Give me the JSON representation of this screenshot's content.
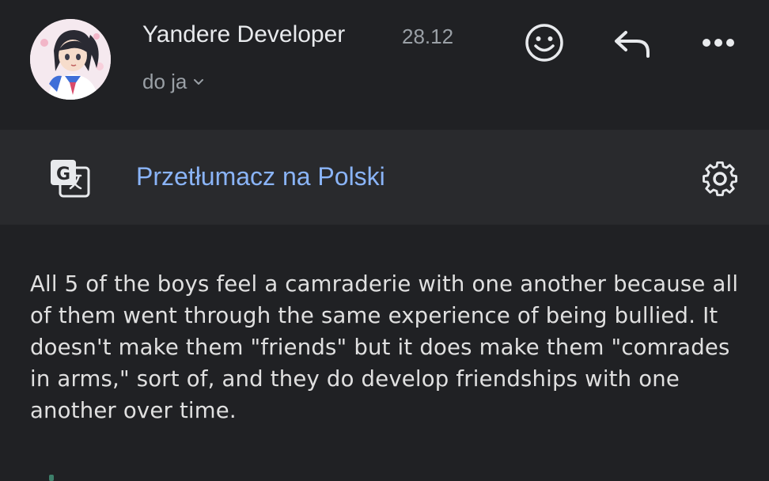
{
  "email": {
    "sender_name": "Yandere Developer",
    "date": "28.12",
    "recipient_label": "do ja",
    "body": "All 5 of the boys feel a camraderie with one another because all of them went through the same experience of being bullied. It doesn't make them \"friends\" but it does make them \"comrades in arms,\" sort of, and they do develop friendships with one another over time."
  },
  "toolbar": {
    "icons": [
      "emoji-icon",
      "reply-icon",
      "more-icon"
    ]
  },
  "translate": {
    "link_label": "Przetłumacz na Polski",
    "icons": [
      "google-translate-icon",
      "gear-icon"
    ]
  },
  "colors": {
    "background": "#202124",
    "translate_bar": "#292a2d",
    "link": "#8ab4f8",
    "muted": "#9aa0a6"
  }
}
